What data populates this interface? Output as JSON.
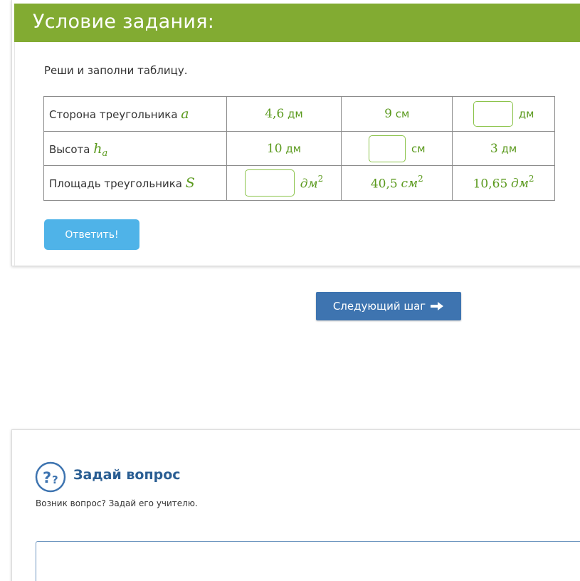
{
  "task": {
    "title": "Условие задания:",
    "instruction": "Реши и заполни таблицу.",
    "table": {
      "rows": [
        {
          "label": "Сторона треугольника",
          "var": "a",
          "cells": [
            {
              "num": "4,6",
              "unit": "дм"
            },
            {
              "num": "9",
              "unit": "см"
            },
            {
              "input": true,
              "unit": "дм"
            }
          ]
        },
        {
          "label": "Высота",
          "var": "h",
          "sub": "a",
          "cells": [
            {
              "num": "10",
              "unit": "дм"
            },
            {
              "input": true,
              "unit": "см"
            },
            {
              "num": "3",
              "unit": "дм"
            }
          ]
        },
        {
          "label": "Площадь треугольника",
          "var": "S",
          "cells": [
            {
              "input": true,
              "unit": "дм",
              "sup": "2"
            },
            {
              "num": "40,5",
              "unit": "см",
              "sup": "2"
            },
            {
              "num": "10,65",
              "unit": "дм",
              "sup": "2"
            }
          ]
        }
      ]
    },
    "answer_button": "Ответить!"
  },
  "next_step_button": "Следующий шаг",
  "question": {
    "title": "Задай вопрос",
    "subtitle": "Возник вопрос? Задай его учителю.",
    "icon_text": "??"
  },
  "colors": {
    "header_green": "#82ab32",
    "value_green": "#5b9a1e",
    "answer_blue": "#4fb3e8",
    "next_blue": "#3e74b0",
    "question_title_blue": "#2a5e93"
  }
}
